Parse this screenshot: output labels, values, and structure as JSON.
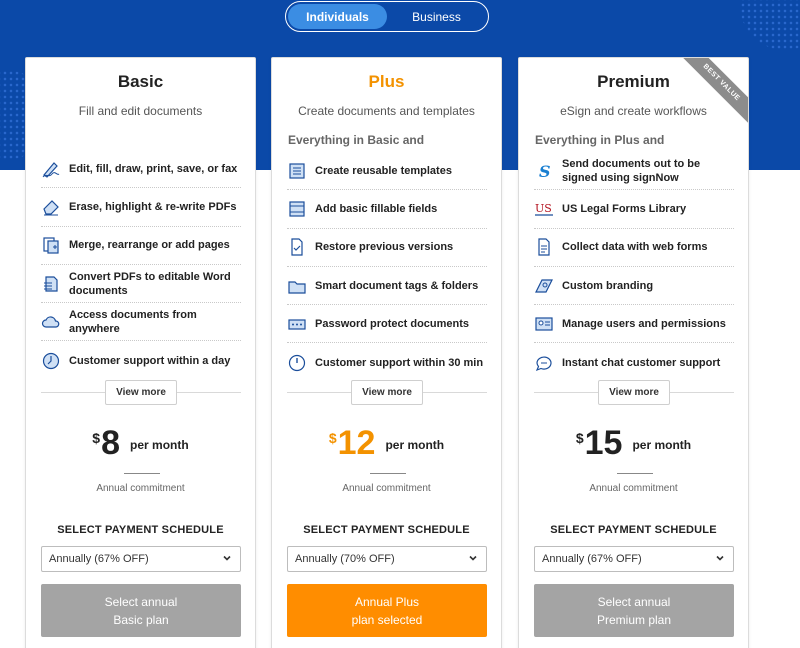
{
  "toggle": {
    "options": [
      "Individuals",
      "Business"
    ],
    "active": "Individuals"
  },
  "plans": [
    {
      "name": "Basic",
      "subtitle": "Fill and edit documents",
      "everything_text": "",
      "features": [
        {
          "icon": "pen-signature-icon",
          "label": "Edit, fill, draw, print, save, or fax"
        },
        {
          "icon": "eraser-icon",
          "label": "Erase, highlight & re-write PDFs"
        },
        {
          "icon": "merge-pages-icon",
          "label": "Merge, rearrange or add pages"
        },
        {
          "icon": "convert-document-icon",
          "label": "Convert PDFs to editable Word documents"
        },
        {
          "icon": "cloud-icon",
          "label": "Access documents from anywhere"
        },
        {
          "icon": "clock-support-icon",
          "label": "Customer support within a day"
        }
      ],
      "view_more": "View more",
      "currency": "$",
      "price": "8",
      "per": "per month",
      "commitment": "Annual commitment",
      "schedule_label": "SELECT PAYMENT SCHEDULE",
      "schedule_value": "Annually (67% OFF)",
      "cta_line1": "Select annual",
      "cta_line2": "Basic plan"
    },
    {
      "name": "Plus",
      "subtitle": "Create documents and templates",
      "everything_text": "Everything in Basic and",
      "features": [
        {
          "icon": "template-icon",
          "label": "Create reusable templates"
        },
        {
          "icon": "fillable-fields-icon",
          "label": "Add basic fillable fields"
        },
        {
          "icon": "restore-version-icon",
          "label": "Restore previous versions"
        },
        {
          "icon": "folder-icon",
          "label": "Smart document tags & folders"
        },
        {
          "icon": "password-icon",
          "label": "Password protect documents"
        },
        {
          "icon": "clock-support-icon",
          "label": "Customer support within 30 min"
        }
      ],
      "view_more": "View more",
      "currency": "$",
      "price": "12",
      "per": "per month",
      "commitment": "Annual commitment",
      "schedule_label": "SELECT PAYMENT SCHEDULE",
      "schedule_value": "Annually (70% OFF)",
      "cta_line1": "Annual Plus",
      "cta_line2": "plan selected"
    },
    {
      "name": "Premium",
      "subtitle": "eSign and create workflows",
      "everything_text": "Everything in Plus and",
      "badge": "BEST VALUE",
      "features": [
        {
          "icon": "signnow-icon",
          "label": "Send documents out to be signed using signNow"
        },
        {
          "icon": "us-legal-forms-icon",
          "label": "US Legal Forms Library"
        },
        {
          "icon": "web-form-icon",
          "label": "Collect data with web forms"
        },
        {
          "icon": "branding-icon",
          "label": "Custom branding"
        },
        {
          "icon": "users-permissions-icon",
          "label": "Manage users and permissions"
        },
        {
          "icon": "chat-icon",
          "label": "Instant chat customer support"
        }
      ],
      "view_more": "View more",
      "currency": "$",
      "price": "15",
      "per": "per month",
      "commitment": "Annual commitment",
      "schedule_label": "SELECT PAYMENT SCHEDULE",
      "schedule_value": "Annually (67% OFF)",
      "cta_line1": "Select annual",
      "cta_line2": "Premium plan"
    }
  ],
  "colors": {
    "hero": "#0b49a8",
    "accent_orange": "#ff8d00",
    "cta_grey": "#a4a4a4",
    "toggle_active": "#3b8de3"
  }
}
